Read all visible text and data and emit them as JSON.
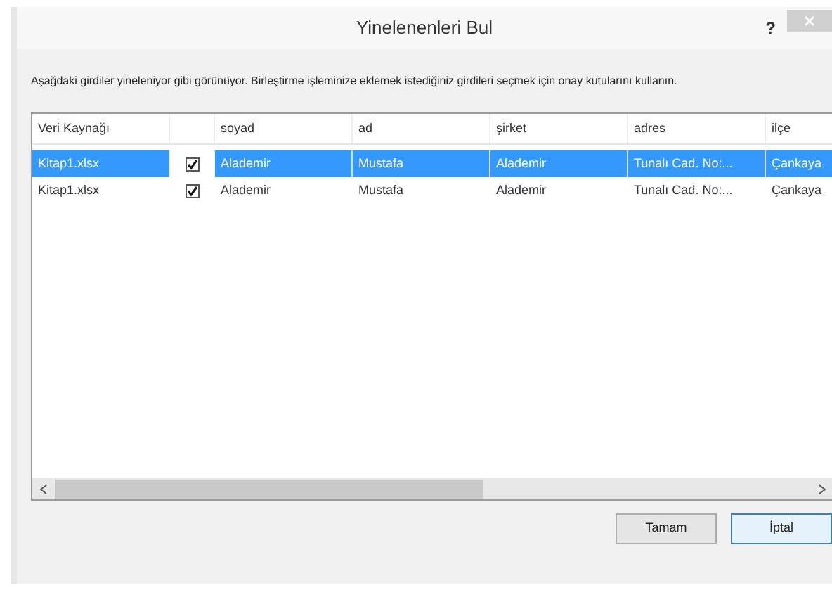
{
  "window": {
    "title": "Yinelenenleri Bul",
    "help": "?"
  },
  "instructions": "Aşağdaki girdiler yineleniyor gibi görünüyor. Birleştirme işleminize eklemek istediğiniz girdileri seçmek için onay kutularını kullanın.",
  "table": {
    "columns": [
      "Veri Kaynağı",
      "",
      "soyad",
      "ad",
      "şirket",
      "adres",
      "ilçe"
    ],
    "rows": [
      {
        "selected": true,
        "cells": [
          {
            "kind": "text",
            "text": "Kitap1.xlsx"
          },
          {
            "kind": "checkbox",
            "checked": true
          },
          {
            "kind": "text",
            "text": "Alademir"
          },
          {
            "kind": "text",
            "text": "Mustafa"
          },
          {
            "kind": "text",
            "text": "Alademir"
          },
          {
            "kind": "text",
            "text": "Tunalı Cad. No:..."
          },
          {
            "kind": "text",
            "text": "Çankaya"
          }
        ]
      },
      {
        "selected": false,
        "cells": [
          {
            "kind": "text",
            "text": "Kitap1.xlsx"
          },
          {
            "kind": "checkbox",
            "checked": true
          },
          {
            "kind": "text",
            "text": "Alademir"
          },
          {
            "kind": "text",
            "text": "Mustafa"
          },
          {
            "kind": "text",
            "text": "Alademir"
          },
          {
            "kind": "text",
            "text": "Tunalı Cad. No:..."
          },
          {
            "kind": "text",
            "text": "Çankaya"
          }
        ]
      }
    ]
  },
  "buttons": [
    {
      "label": "Tamam",
      "selected": false
    },
    {
      "label": "İptal",
      "selected": true
    }
  ]
}
